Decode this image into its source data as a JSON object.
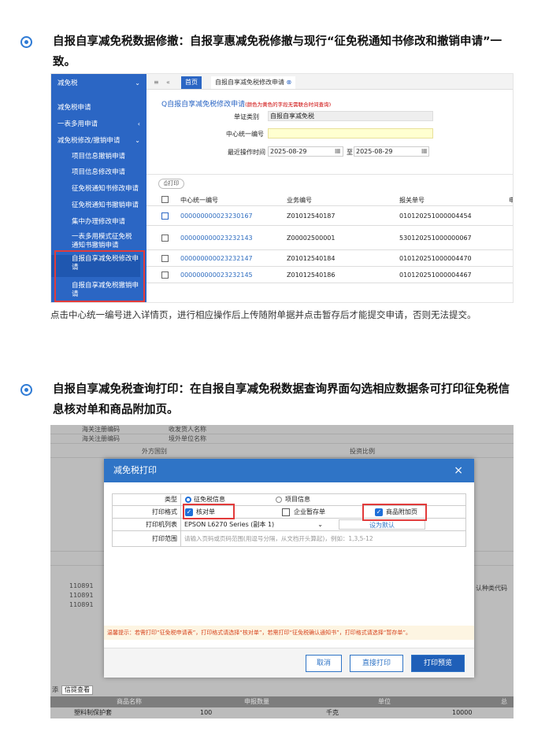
{
  "section1": {
    "heading": "自报自享减免税数据修撤：自报享惠减免税修撤与现行“征免税通知书修改和撤销申请”一致。",
    "note": "点击中心统一编号进入详情页，进行相应操作后上传随附单据并点击暂存后才能提交申请，否则无法提交。"
  },
  "section2": {
    "heading": "自报自享减免税查询打印：在自报自享减免税数据查询界面勾选相应数据条可打印征免税信息核对单和商品附加页。"
  },
  "s1": {
    "sidebar": {
      "title": "减免税",
      "items": [
        "减免税申请",
        "一表多用申请",
        "减免税修改/撤销申请",
        "项目信息撤销申请",
        "项目信息修改申请",
        "征免税通知书修改申请",
        "征免税通知书撤销申请",
        "集中办理修改申请",
        "一表多用模式征免税通知书撤销申请",
        "自报自享减免税修改申请",
        "自报自享减免税撤销申请"
      ]
    },
    "tabs": {
      "home": "首页",
      "active": "自报自享减免税修改申请"
    },
    "query": {
      "title": "自报自享减免税修改申请",
      "hint": "(颜色为黄色的字段无需联合时间查询)",
      "f1_label": "单证类别",
      "f1_value": "自报自享减免税",
      "f2_label": "中心统一编号",
      "f3_label": "最近操作时间",
      "date_from": "2025-08-29",
      "date_sep": "至",
      "date_to": "2025-08-29"
    },
    "print": "打印",
    "table": {
      "headers": [
        "中心统一编号",
        "业务编号",
        "报关单号"
      ],
      "rows": [
        [
          "000000000023230167",
          "Z01012540187",
          "010120251000004454"
        ],
        [
          "000000000023232143",
          "Z00002500001",
          "530120251000000067"
        ],
        [
          "000000000023232147",
          "Z01012540184",
          "010120251000004470"
        ],
        [
          "000000000023232145",
          "Z01012540186",
          "010120251000004467"
        ]
      ]
    }
  },
  "s2": {
    "bg": {
      "r1a": "海关注册编码",
      "r1b": "收发货人名称",
      "r2a": "海关注册编码",
      "r2b": "境外单位名称",
      "r3a": "外方国别",
      "r3b": "投资比例",
      "c1": "110891",
      "c2": "110891",
      "c3": "110891",
      "right": "认种类代码",
      "tabs_l": "添",
      "tabs_r": "信提查看",
      "gh": [
        "商品名称",
        "申报数量",
        "单位",
        "总"
      ],
      "gr": [
        "塑料制保护套",
        "100",
        "千克",
        "10000"
      ]
    },
    "dialog": {
      "title": "减免税打印",
      "close": "×",
      "type_label": "类型",
      "type_opt1": "征免税信息",
      "type_opt2": "项目信息",
      "fmt_label": "打印格式",
      "fmt_opt1": "核对单",
      "fmt_opt2": "企业暂存单",
      "fmt_opt3": "商品附加页",
      "printer_label": "打印机列表",
      "printer_value": "EPSON L6270 Series (副本 1)",
      "set_default": "设为默认",
      "range_label": "打印范围",
      "range_placeholder": "请输入页码或页码范围(用逗号分隔，从文档开头算起)，例如：1,3,5-12",
      "tip": "温馨提示：若需打印“征免税申请表”，打印格式请选择“核对单”，若需打印“征免税确认通知书”，打印格式请选择“暂存单”。",
      "cancel": "取消",
      "direct": "直接打印",
      "preview": "打印预览"
    }
  },
  "colors": {
    "accent": "#2f7bd5",
    "sidebar": "#2b66c4",
    "highlight": "#e23b3b"
  }
}
